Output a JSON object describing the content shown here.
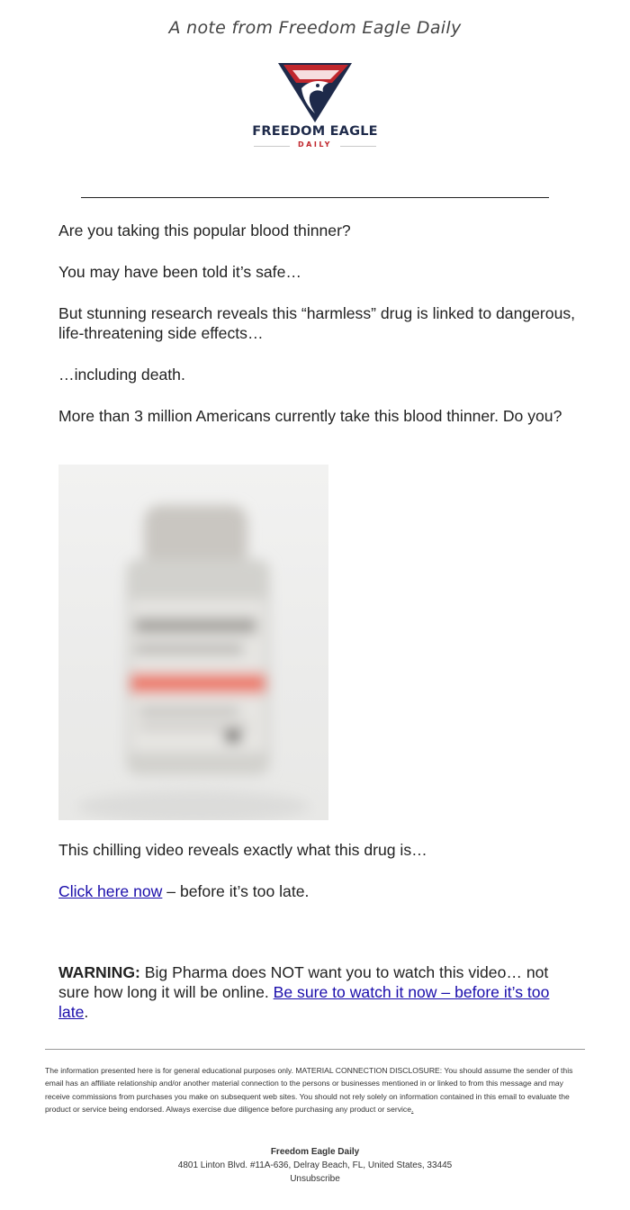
{
  "header": {
    "note": "A note from Freedom Eagle Daily"
  },
  "logo": {
    "name": "FREEDOM EAGLE",
    "sub": "DAILY",
    "icon": "eagle-shield-icon",
    "colors": {
      "navy": "#1e2a4a",
      "red": "#c0272d"
    }
  },
  "body": {
    "p1": "Are you taking this popular blood thinner?",
    "p2": "You may have been told it’s safe…",
    "p3": "But stunning research reveals this “harmless” drug is linked to dangerous, life-threatening side effects…",
    "p4": "…including death.",
    "p5": "More than 3 million Americans currently take this blood thinner. Do you?"
  },
  "lower": {
    "p1": "This chilling video reveals exactly what this drug is…",
    "cta_link": "Click here now",
    "cta_rest": " – before it’s too late."
  },
  "warning": {
    "label": "WARNING:",
    "text": " Big Pharma does NOT want you to watch this video… not sure how long it will be online. ",
    "link": "Be sure to watch it now – before it’s too late",
    "end": "."
  },
  "footer": {
    "disclosure": "The information presented here is for general educational purposes only. MATERIAL CONNECTION DISCLOSURE: You should assume the sender of this email has an affiliate relationship and/or another material connection to the persons or businesses mentioned in or linked to from this message and may receive commissions from purchases you make on subsequent web sites. You should not rely solely on information contained in this email to evaluate the product or service being endorsed. Always exercise due diligence before purchasing any product or service",
    "disclosure_end": ".",
    "company": "Freedom Eagle Daily",
    "address": "4801 Linton Blvd. #11A-636, Delray Beach, FL, United States, 33445",
    "unsubscribe": "Unsubscribe"
  },
  "colors": {
    "link": "#1a0dab",
    "text": "#222222"
  }
}
